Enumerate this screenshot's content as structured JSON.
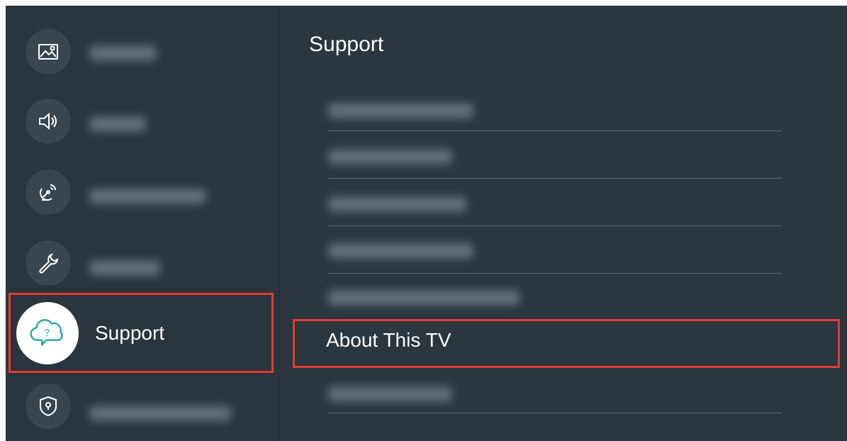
{
  "left_menu": {
    "items": [
      {
        "icon": "picture-icon"
      },
      {
        "icon": "sound-icon"
      },
      {
        "icon": "broadcasting-icon"
      },
      {
        "icon": "general-wrench-icon"
      },
      {
        "icon": "support-cloud-icon",
        "label": "Support",
        "selected": true
      },
      {
        "icon": "privacy-shield-icon"
      }
    ]
  },
  "right_panel": {
    "title": "Support",
    "selected_item": "About This TV"
  },
  "colors": {
    "background": "#2a353d",
    "highlight_border": "#e53935",
    "text": "#ffffff"
  }
}
